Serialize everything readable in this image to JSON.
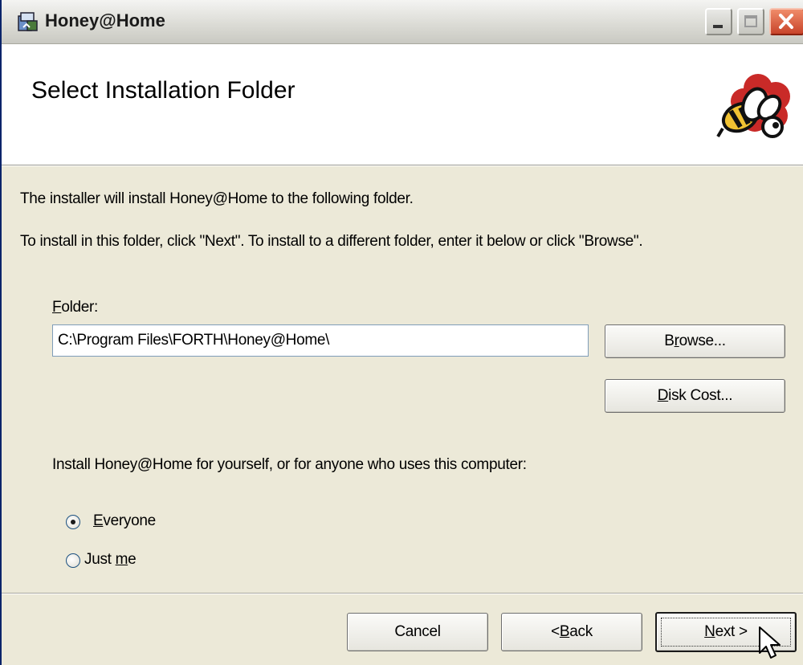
{
  "window": {
    "title": "Honey@Home"
  },
  "header": {
    "title": "Select Installation Folder"
  },
  "body": {
    "line1": "The installer will install Honey@Home to the following folder.",
    "line2": "To install in this folder, click \"Next\". To install to a different folder, enter it below or click \"Browse\"."
  },
  "folder": {
    "label_accel": "F",
    "label_rest": "older:",
    "value": "C:\\Program Files\\FORTH\\Honey@Home\\"
  },
  "buttons": {
    "browse_pre": "B",
    "browse_accel": "r",
    "browse_post": "owse...",
    "diskcost_accel": "D",
    "diskcost_post": "isk Cost...",
    "cancel": "Cancel",
    "back_pre": "< ",
    "back_accel": "B",
    "back_post": "ack",
    "next_accel": "N",
    "next_post": "ext >"
  },
  "scope": {
    "prompt": "Install Honey@Home for yourself, or for anyone who uses this computer:",
    "everyone_accel": "E",
    "everyone_post": "veryone",
    "justme_pre": "Just ",
    "justme_accel": "m",
    "justme_post": "e",
    "selected": "Everyone"
  },
  "colors": {
    "titlebar": "#dcdcd6",
    "close": "#c8442a",
    "dialog_bg": "#ece9d8"
  },
  "icons": [
    "installer-icon",
    "minimize-icon",
    "maximize-icon",
    "close-icon",
    "bee-logo-icon",
    "cursor-icon"
  ]
}
